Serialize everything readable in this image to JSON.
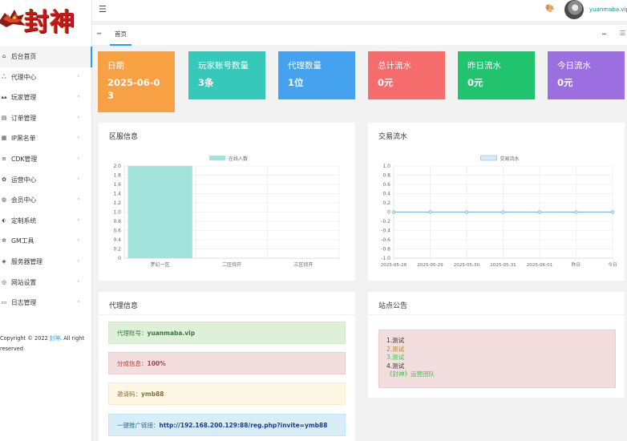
{
  "brand": {
    "logo_text": "封神"
  },
  "header": {
    "username": "yuanmaba.vip"
  },
  "tabs": {
    "home": "首页"
  },
  "sidebar": {
    "items": [
      {
        "label": "后台首页",
        "icon": "home-icon",
        "glyph": "⌂",
        "arrow": "",
        "active": true
      },
      {
        "label": "代理中心",
        "icon": "agents-icon",
        "glyph": "ஃ",
        "arrow": "›"
      },
      {
        "label": "玩家管理",
        "icon": "users-icon",
        "glyph": "▴▴",
        "arrow": "›"
      },
      {
        "label": "订单管理",
        "icon": "order-icon",
        "glyph": "▤",
        "arrow": "›"
      },
      {
        "label": "IP黑名单",
        "icon": "blacklist-icon",
        "glyph": "▦",
        "arrow": "›"
      },
      {
        "label": "CDK管理",
        "icon": "cdk-icon",
        "glyph": "≡",
        "arrow": "›"
      },
      {
        "label": "运营中心",
        "icon": "gear-icon",
        "glyph": "✿",
        "arrow": "›"
      },
      {
        "label": "会员中心",
        "icon": "member-icon",
        "glyph": "◍",
        "arrow": "›"
      },
      {
        "label": "定制系统",
        "icon": "custom-icon",
        "glyph": "⬖",
        "arrow": "›"
      },
      {
        "label": "GM工具",
        "icon": "bug-icon",
        "glyph": "✲",
        "arrow": "›"
      },
      {
        "label": "服务器管理",
        "icon": "server-icon",
        "glyph": "◈",
        "arrow": "›"
      },
      {
        "label": "网站设置",
        "icon": "settings-icon",
        "glyph": "◎",
        "arrow": "›"
      },
      {
        "label": "日志管理",
        "icon": "log-icon",
        "glyph": "▭",
        "arrow": "›"
      }
    ],
    "copyright_prefix": "Copyright © 2022 ",
    "copyright_brand": "封神",
    "copyright_suffix": ". All right reserved"
  },
  "stats": [
    {
      "title": "日期",
      "value": "2025-06-03",
      "color": "#f7a144"
    },
    {
      "title": "玩家账号数量",
      "value": "3条",
      "color": "#36c8b8"
    },
    {
      "title": "代理数量",
      "value": "1位",
      "color": "#45a2ef"
    },
    {
      "title": "总计流水",
      "value": "0元",
      "color": "#f66b6b"
    },
    {
      "title": "昨日流水",
      "value": "0元",
      "color": "#22c36f"
    },
    {
      "title": "今日流水",
      "value": "0元",
      "color": "#9c6fe0"
    }
  ],
  "panels": {
    "server_title": "区服信息",
    "trade_title": "交易流水",
    "agent_title": "代理信息",
    "notice_title": "站点公告"
  },
  "chart_data": [
    {
      "type": "bar",
      "categories": [
        "梦幻一区",
        "二区待开",
        "三区待开"
      ],
      "series": [
        {
          "name": "在线人数",
          "values": [
            2,
            0,
            0
          ],
          "color": "#a2e3dc"
        }
      ],
      "ylim": [
        0,
        2.0
      ],
      "yticks": [
        "0",
        "0.2",
        "0.4",
        "0.6",
        "0.8",
        "1.0",
        "1.2",
        "1.4",
        "1.6",
        "1.8",
        "2.0"
      ],
      "legend": "top-center",
      "grid": true
    },
    {
      "type": "line",
      "categories": [
        "2025-05-28",
        "2025-05-29",
        "2025-05-30",
        "2025-05-31",
        "2025-06-01",
        "昨日",
        "今日"
      ],
      "series": [
        {
          "name": "交易流水",
          "values": [
            0,
            0,
            0,
            0,
            0,
            0,
            0
          ],
          "color": "#7fb8e0"
        }
      ],
      "ylim": [
        -1.0,
        1.0
      ],
      "yticks": [
        "-1.0",
        "-0.8",
        "-0.6",
        "-0.4",
        "-0.2",
        "0",
        "0.2",
        "0.4",
        "0.6",
        "0.8",
        "1.0"
      ],
      "legend": "top-center",
      "grid": true
    }
  ],
  "agent_info": {
    "account_label": "代理账号：",
    "account_value": "yuanmaba.vip",
    "share_label": "分成信息：",
    "share_value": "100%",
    "invite_label": "邀请码：",
    "invite_value": "ymb88",
    "link_label": "一键推广链接：",
    "link_value": "http://192.168.200.129:88/reg.php?invite=ymb88"
  },
  "notice": {
    "lines": [
      {
        "text": "1.测试",
        "color": "#333333"
      },
      {
        "text": "2.测试",
        "color": "#b8860b"
      },
      {
        "text": "3.测试",
        "color": "#2ecc40"
      },
      {
        "text": "4.测试",
        "color": "#333333"
      },
      {
        "text": "《封神》运营团队",
        "color": "#2ecc40"
      }
    ]
  }
}
